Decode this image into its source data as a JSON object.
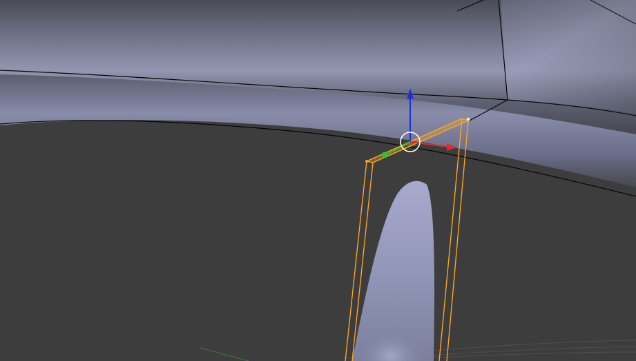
{
  "viewport": {
    "mode": "3d-viewport-edit-mode",
    "background_color": "#3f3f3f",
    "mesh_surface_color": "#8c91ad",
    "mesh_dark_color": "#383838",
    "selection_color": "#ffa51f",
    "selection_active_color": "#fff3b0",
    "edge_color": "#000000"
  },
  "gizmo": {
    "x_axis_color": "#e02b2b",
    "y_axis_color": "#29c729",
    "z_axis_color": "#1f2fe0",
    "center_ring_color": "#ffffff"
  },
  "grid": {
    "line_color": "#4f4f4f",
    "y_axis_line_color": "#3a7a3a"
  }
}
